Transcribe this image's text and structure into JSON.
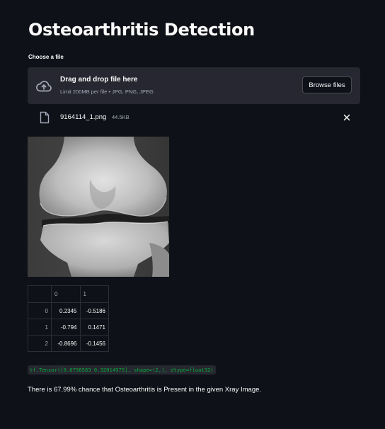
{
  "page": {
    "title": "Osteoarthritis Detection"
  },
  "uploader": {
    "label": "Choose a file",
    "drop_title": "Drag and drop file here",
    "drop_limit": "Limit 200MB per file • JPG, PNG, JPEG",
    "browse_label": "Browse files",
    "cloud_icon": "cloud-upload-icon"
  },
  "uploaded_file": {
    "name": "9164114_1.png",
    "size": "44.5KB",
    "file_icon": "file-icon",
    "remove_icon": "close-icon"
  },
  "image": {
    "subject": "knee-xray"
  },
  "dataframe": {
    "columns": [
      "",
      "0",
      "1"
    ],
    "rows": [
      {
        "index": "0",
        "c0": "0.2345",
        "c1": "-0.5186"
      },
      {
        "index": "1",
        "c0": "-0.794",
        "c1": "0.1471"
      },
      {
        "index": "2",
        "c0": "-0.8696",
        "c1": "-0.1456"
      }
    ]
  },
  "output": {
    "tensor_text": "tf.Tensor([0.6798583 0.32014975], shape=(2,), dtype=float32)",
    "result_text": "There is 67.99% chance that Osteoarthritis is Present in the given Xray Image."
  },
  "colors": {
    "background": "#0e1117",
    "panel": "#262730",
    "code_green": "#09ab3b",
    "text": "#fafafa",
    "muted": "#a3a8b8"
  }
}
